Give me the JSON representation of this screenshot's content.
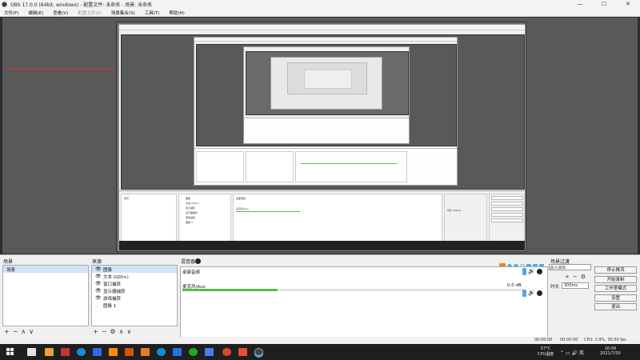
{
  "window": {
    "title": "OBS 17.0.0 (64bit, windows) - 配置文件: 未命名 - 场景: 未命名",
    "watermark": "",
    "controls": [
      "—",
      "☐",
      "✕"
    ]
  },
  "menu": {
    "items": [
      "文件(F)",
      "编辑(E)",
      "查看(V)",
      "配置文件(P)",
      "场景集合(S)",
      "工具(T)",
      "帮助(H)"
    ]
  },
  "docks": {
    "scenes": {
      "title": "场景",
      "items": [
        "场景"
      ]
    },
    "sources": {
      "title": "来源",
      "items": [
        {
          "label": "图像",
          "visible": true,
          "selected": true
        },
        {
          "label": "文本 (GDI+)",
          "visible": true,
          "selected": false
        },
        {
          "label": "窗口捕获",
          "visible": true,
          "selected": false
        },
        {
          "label": "显示器捕获",
          "visible": true,
          "selected": false
        },
        {
          "label": "游戏捕获",
          "visible": true,
          "selected": false
        },
        {
          "label": "图像 1",
          "visible": false,
          "selected": false
        }
      ]
    },
    "mixer": {
      "title": "混音器",
      "tracks": [
        {
          "name": "桌面音频",
          "level": 0.0,
          "db": ""
        },
        {
          "name": "麦克风/Aux",
          "level": 0.28,
          "db": "0.0 dB"
        }
      ]
    },
    "transitions": {
      "title": "场景过渡",
      "selected": "淡入淡出",
      "duration_label": "时长",
      "duration_value": "300ms"
    },
    "controls": {
      "buttons": [
        "停止推流",
        "开始录制",
        "工作室模式",
        "设置",
        "退出"
      ]
    },
    "toolbar": {
      "add": "+",
      "remove": "−",
      "gear": "⚙",
      "up": "∧",
      "down": "∨"
    }
  },
  "status": {
    "rec_time": "00:00:00",
    "stream_time": "00:00:00",
    "cpu": "CPU: 1.9%, 30.00 fps"
  },
  "taskbar": {
    "temp": "57°C",
    "temp_label": "CPU温度",
    "time": "16:09",
    "date": "2021/7/30"
  },
  "colors": {
    "accent": "#4fa9e4",
    "meter": "#5aba4a",
    "preview_bg": "#595959",
    "selection": "#cfe3fb"
  }
}
